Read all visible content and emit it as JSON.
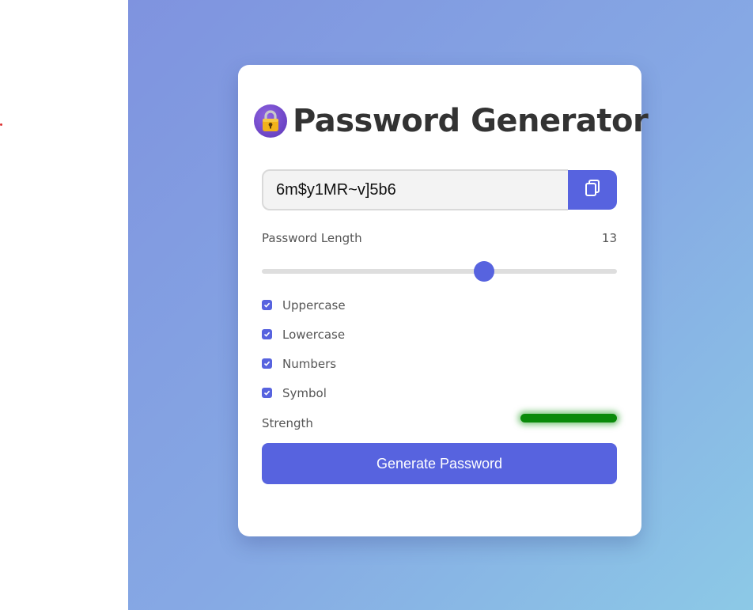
{
  "app": {
    "title": "Password Generator"
  },
  "password": {
    "value": "6m$y1MR~v]5b6",
    "copy_icon": "copy-icon"
  },
  "length": {
    "label": "Password Length",
    "value": "13",
    "slider_fraction": 0.625
  },
  "options": [
    {
      "label": "Uppercase",
      "checked": true
    },
    {
      "label": "Lowercase",
      "checked": true
    },
    {
      "label": "Numbers",
      "checked": true
    },
    {
      "label": "Symbol",
      "checked": true
    }
  ],
  "strength": {
    "label": "Strength",
    "color": "#0a8a0a"
  },
  "generate": {
    "label": "Generate Password"
  },
  "colors": {
    "accent": "#5763df",
    "title": "#333333"
  }
}
